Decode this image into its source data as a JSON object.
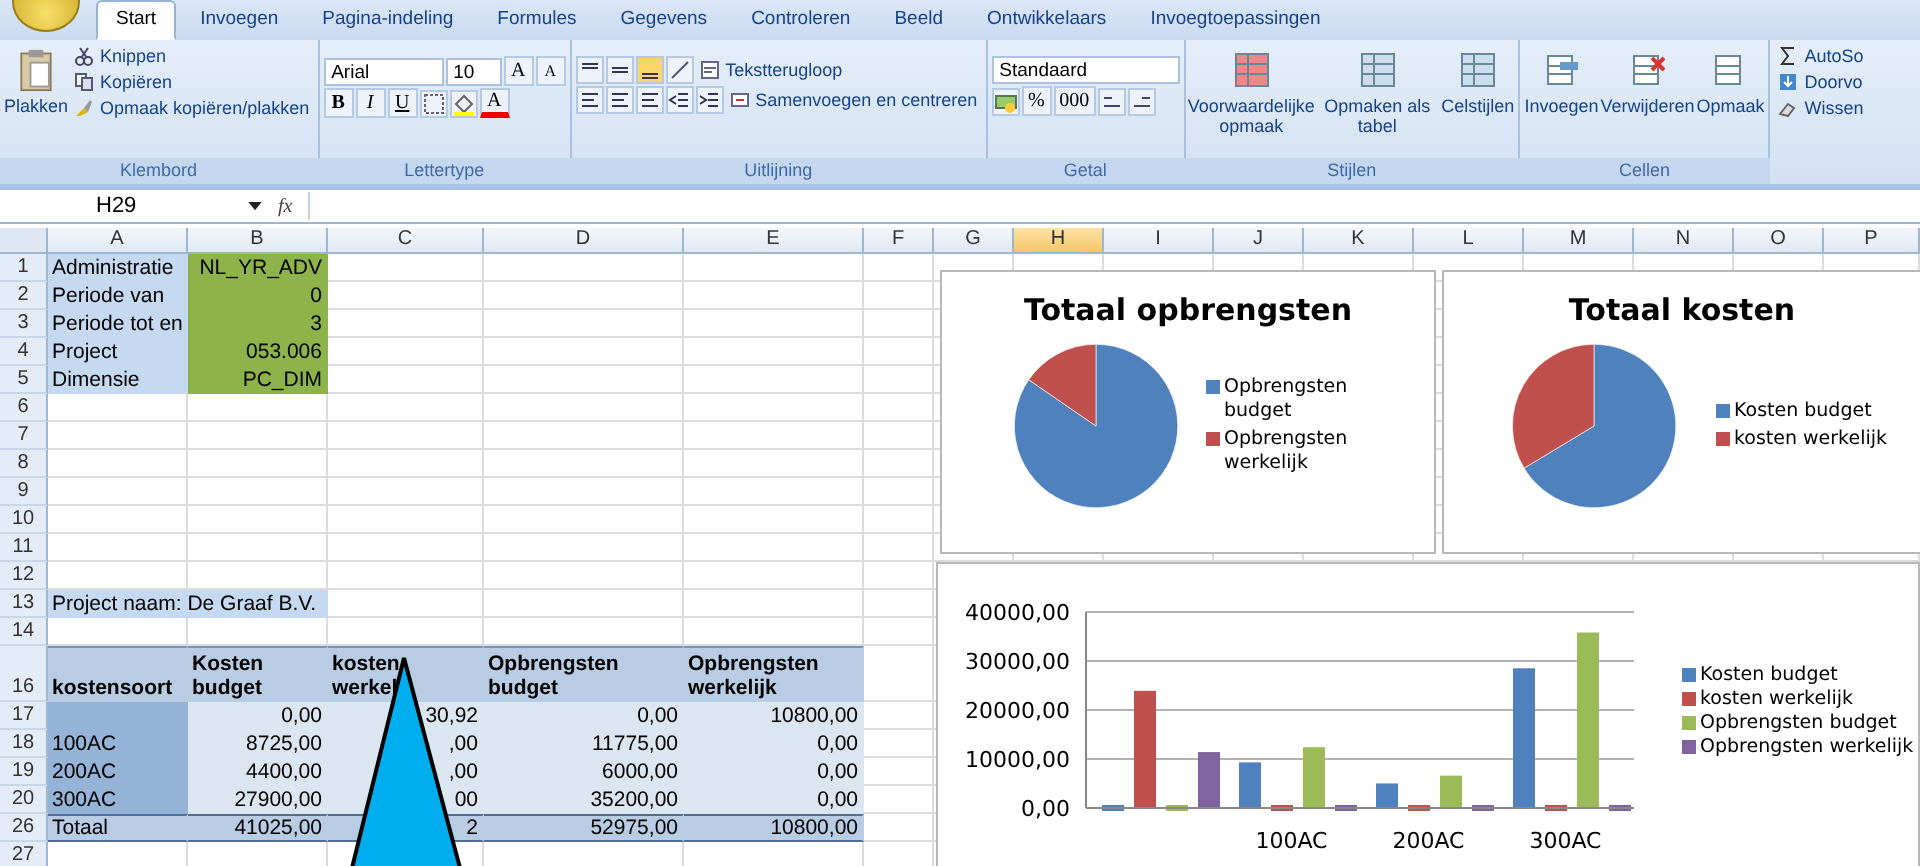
{
  "tabs": [
    {
      "label": "Start",
      "selected": true
    },
    {
      "label": "Invoegen",
      "selected": false
    },
    {
      "label": "Pagina-indeling",
      "selected": false
    },
    {
      "label": "Formules",
      "selected": false
    },
    {
      "label": "Gegevens",
      "selected": false
    },
    {
      "label": "Controleren",
      "selected": false
    },
    {
      "label": "Beeld",
      "selected": false
    },
    {
      "label": "Ontwikkelaars",
      "selected": false
    },
    {
      "label": "Invoegtoepassingen",
      "selected": false
    }
  ],
  "ribbon": {
    "klembord": {
      "label": "Klembord",
      "paste": "Plakken",
      "items": [
        "Knippen",
        "Kopiëren",
        "Opmaak kopiëren/plakken"
      ]
    },
    "lettertype": {
      "label": "Lettertype",
      "font": "Arial",
      "size": "10",
      "grow": "A",
      "shrink": "A",
      "format": [
        "B",
        "I",
        "U"
      ],
      "font_color": "A"
    },
    "uitlijning": {
      "label": "Uitlijning",
      "wrap": "Tekstterugloop",
      "merge": "Samenvoegen en centreren"
    },
    "getal": {
      "label": "Getal",
      "format": "Standaard",
      "percent": "%",
      "thousands": "000"
    },
    "stijlen": {
      "label": "Stijlen",
      "items": [
        "Voorwaardelijke opmaak",
        "Opmaken als tabel",
        "Celstijlen"
      ]
    },
    "cellen": {
      "label": "Cellen",
      "items": [
        "Invoegen",
        "Verwijderen",
        "Opmaak"
      ]
    },
    "bewerken": {
      "items": [
        "AutoSo",
        "Doorvo",
        "Wissen"
      ]
    }
  },
  "formula_bar": {
    "name_box": "H29",
    "fx": "fx"
  },
  "sheet": {
    "columns": [
      {
        "label": "A",
        "selected": false
      },
      {
        "label": "B",
        "selected": false
      },
      {
        "label": "C",
        "selected": false
      },
      {
        "label": "D",
        "selected": false
      },
      {
        "label": "E",
        "selected": false
      },
      {
        "label": "F",
        "selected": false
      },
      {
        "label": "G",
        "selected": false
      },
      {
        "label": "H",
        "selected": true
      },
      {
        "label": "I",
        "selected": false
      },
      {
        "label": "J",
        "selected": false
      },
      {
        "label": "K",
        "selected": false
      },
      {
        "label": "L",
        "selected": false
      },
      {
        "label": "M",
        "selected": false
      },
      {
        "label": "N",
        "selected": false
      },
      {
        "label": "O",
        "selected": false
      },
      {
        "label": "P",
        "selected": false
      }
    ],
    "rows": [
      {
        "num": "1",
        "kind": "param",
        "cells": [
          "Administratie",
          "NL_YR_ADV"
        ]
      },
      {
        "num": "2",
        "kind": "param",
        "cells": [
          "Periode van",
          "0"
        ]
      },
      {
        "num": "3",
        "kind": "param",
        "cells": [
          "Periode tot en",
          "3"
        ]
      },
      {
        "num": "4",
        "kind": "param",
        "cells": [
          "Project",
          "053.006"
        ]
      },
      {
        "num": "5",
        "kind": "param",
        "cells": [
          "Dimensie",
          "PC_DIM"
        ]
      },
      {
        "num": "6",
        "kind": "blank",
        "cells": []
      },
      {
        "num": "7",
        "kind": "blank",
        "cells": []
      },
      {
        "num": "8",
        "kind": "blank",
        "cells": []
      },
      {
        "num": "9",
        "kind": "blank",
        "cells": []
      },
      {
        "num": "10",
        "kind": "blank",
        "cells": []
      },
      {
        "num": "11",
        "kind": "blank",
        "cells": []
      },
      {
        "num": "12",
        "kind": "blank",
        "cells": []
      },
      {
        "num": "13",
        "kind": "title",
        "cells": [
          "Project naam: De Graaf B.V."
        ]
      },
      {
        "num": "14",
        "kind": "blank",
        "cells": []
      },
      {
        "num": "16",
        "kind": "header",
        "cells": [
          "kostensoort",
          "Kosten budget",
          "kosten werkel",
          "Opbrengsten budget",
          "Opbrengsten werkelijk"
        ]
      },
      {
        "num": "17",
        "kind": "data",
        "cells": [
          null,
          "0,00",
          "30,92",
          "0,00",
          "10800,00"
        ]
      },
      {
        "num": "18",
        "kind": "data",
        "cells": [
          "100AC",
          "8725,00",
          ",00",
          "11775,00",
          "0,00"
        ]
      },
      {
        "num": "19",
        "kind": "data",
        "cells": [
          "200AC",
          "4400,00",
          ",00",
          "6000,00",
          "0,00"
        ]
      },
      {
        "num": "20",
        "kind": "data",
        "cells": [
          "300AC",
          "27900,00",
          "00",
          "35200,00",
          "0,00"
        ]
      },
      {
        "num": "26",
        "kind": "total",
        "cells": [
          "Totaal",
          "41025,00",
          "2",
          "52975,00",
          "10800,00"
        ]
      },
      {
        "num": "27",
        "kind": "blank",
        "cells": []
      }
    ]
  },
  "pie_charts": [
    {
      "title": "Totaal opbrengsten",
      "legend": [
        {
          "label": "Opbrengsten budget",
          "color": "#4f81bd"
        },
        {
          "label": "Opbrengsten werkelijk",
          "color": "#c0504d"
        }
      ]
    },
    {
      "title": "Totaal kosten",
      "legend": [
        {
          "label": "Kosten budget",
          "color": "#4f81bd"
        },
        {
          "label": "kosten werkelijk",
          "color": "#c0504d"
        }
      ]
    }
  ],
  "bar_chart": {
    "chart_data": {
      "type": "bar",
      "categories": [
        null,
        "100AC",
        "200AC",
        "300AC"
      ],
      "stacked": false,
      "grid": true,
      "series": [
        {
          "name": "Kosten budget",
          "color": "#4f81bd",
          "values": [
            0,
            8700,
            4400,
            27900
          ]
        },
        {
          "name": "kosten werkelijk",
          "color": "#c0504d",
          "values": [
            23300,
            0,
            0,
            0
          ]
        },
        {
          "name": "Opbrengsten budget",
          "color": "#9bbb59",
          "values": [
            0,
            11800,
            6000,
            35200
          ]
        },
        {
          "name": "Opbrengsten werkelijk",
          "color": "#8064a2",
          "values": [
            10800,
            0,
            0,
            0
          ]
        }
      ],
      "ylim": [
        0,
        40000
      ],
      "yticks": [
        {
          "value": 0,
          "label": "0,00"
        },
        {
          "value": 10000,
          "label": "10000,00"
        },
        {
          "value": 20000,
          "label": "20000,00"
        },
        {
          "value": 30000,
          "label": "30000,00"
        },
        {
          "value": 40000,
          "label": "40000,00"
        }
      ]
    }
  }
}
